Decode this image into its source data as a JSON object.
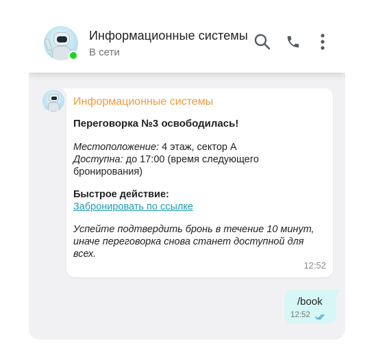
{
  "header": {
    "title": "Информационные системы",
    "status": "В сети",
    "icons": [
      "search-icon",
      "phone-icon",
      "more-vertical-icon"
    ]
  },
  "incoming": {
    "sender": "Информационные системы",
    "headline": "Переговорка №3 освободилась!",
    "location_label": "Местоположение:",
    "location_value": " 4 этаж, сектор А",
    "available_label": "Доступна:",
    "available_value_l1": " до 17:00 (время следующего",
    "available_value_l2": "бронирования)",
    "quick_action_label": "Быстрое действие:",
    "quick_action_link": "Забронировать по ссылке",
    "note_l1": "Успейте подтвердить бронь в течение 10 минут,",
    "note_l2": "иначе переговорка снова станет доступной для",
    "note_l3": "всех.",
    "time": "12:52"
  },
  "outgoing": {
    "text": "/book",
    "time": "12:52",
    "status_icon": "double-check-icon"
  },
  "colors": {
    "sender": "#f19a3e",
    "link": "#1b9bb3",
    "online": "#18d61e",
    "outgoing_bubble": "#d7f6f6",
    "chat_background": "#f1f1f3"
  }
}
